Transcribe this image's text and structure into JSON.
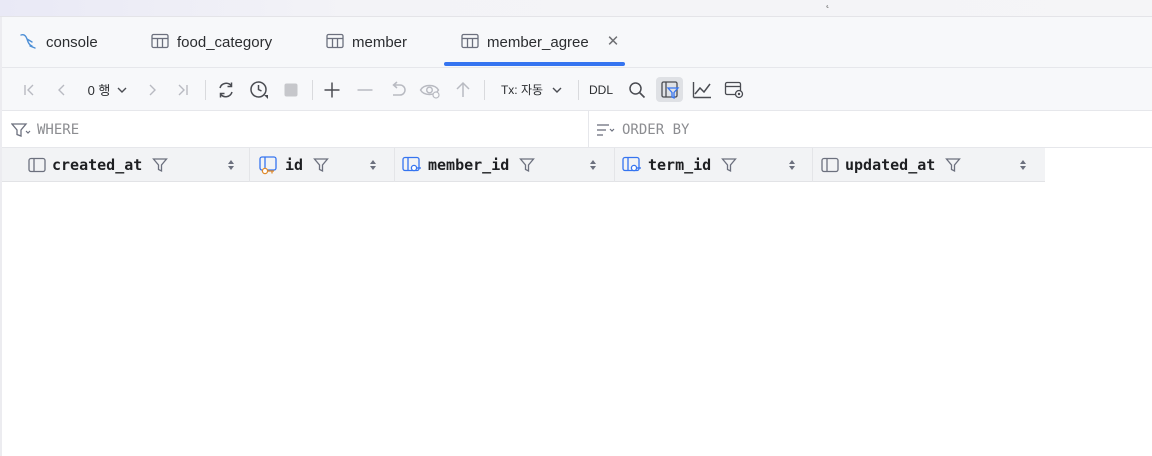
{
  "tabs": [
    {
      "label": "console",
      "icon": "console-icon"
    },
    {
      "label": "food_category",
      "icon": "table-icon"
    },
    {
      "label": "member",
      "icon": "table-icon"
    },
    {
      "label": "member_agree",
      "icon": "table-icon",
      "active": true
    }
  ],
  "toolbar": {
    "row_count": "0 행",
    "tx_mode": "Tx: 자동",
    "ddl": "DDL"
  },
  "filters": {
    "where": "WHERE",
    "order_by": "ORDER BY"
  },
  "columns": [
    {
      "name": "created_at",
      "icon": "column-icon"
    },
    {
      "name": "id",
      "icon": "primary-key-column-icon"
    },
    {
      "name": "member_id",
      "icon": "foreign-key-column-icon"
    },
    {
      "name": "term_id",
      "icon": "foreign-key-column-icon"
    },
    {
      "name": "updated_at",
      "icon": "column-icon"
    }
  ],
  "colors": {
    "accent": "#3574f0",
    "toolbar_bg": "#f7f8fa",
    "header_bg": "#f2f3f5",
    "pk_key": "#e08a2b"
  }
}
